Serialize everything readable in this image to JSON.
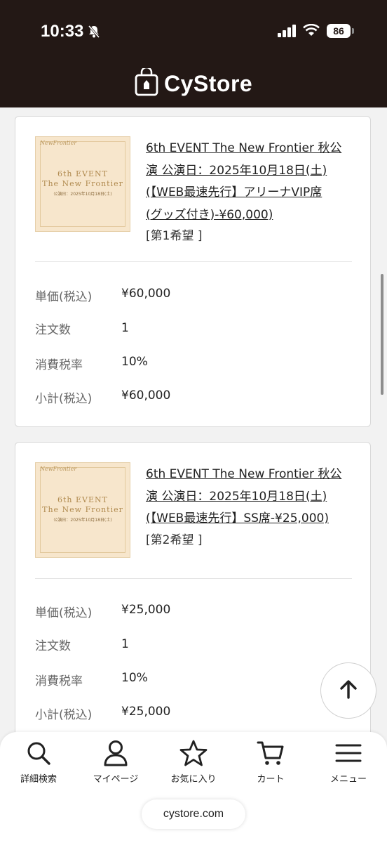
{
  "status": {
    "time": "10:33",
    "battery": "86"
  },
  "header": {
    "logo_text": "CyStore"
  },
  "cards": [
    {
      "thumb": {
        "brand": "NewFrontier",
        "line1": "6th EVENT",
        "line2": "The New Frontier",
        "line3": "公演日：2025年10月18日(土)"
      },
      "title_lines": [
        "6th EVENT The New Frontier 秋公",
        "演 公演日：2025年10月18日(土)",
        "(【WEB最速先行】アリーナVIP席",
        "(グッズ付き)-¥60,000)"
      ],
      "preference": "[第1希望 ]",
      "rows": [
        {
          "label": "単価(税込)",
          "value": "¥60,000"
        },
        {
          "label": "注文数",
          "value": "1"
        },
        {
          "label": "消費税率",
          "value": "10%"
        },
        {
          "label": "小計(税込)",
          "value": "¥60,000"
        }
      ]
    },
    {
      "thumb": {
        "brand": "NewFrontier",
        "line1": "6th EVENT",
        "line2": "The New Frontier",
        "line3": "公演日：2025年10月18日(土)"
      },
      "title_lines": [
        "6th EVENT The New Frontier 秋公",
        "演 公演日：2025年10月18日(土)",
        "(【WEB最速先行】SS席-¥25,000)"
      ],
      "preference": "[第2希望 ]",
      "rows": [
        {
          "label": "単価(税込)",
          "value": "¥25,000"
        },
        {
          "label": "注文数",
          "value": "1"
        },
        {
          "label": "消費税率",
          "value": "10%"
        },
        {
          "label": "小計(税込)",
          "value": "¥25,000"
        }
      ]
    }
  ],
  "nav": [
    {
      "label": "詳細検索",
      "icon": "search-icon"
    },
    {
      "label": "マイページ",
      "icon": "person-icon"
    },
    {
      "label": "お気に入り",
      "icon": "star-icon"
    },
    {
      "label": "カート",
      "icon": "cart-icon"
    },
    {
      "label": "メニュー",
      "icon": "menu-icon"
    }
  ],
  "url": "cystore.com"
}
